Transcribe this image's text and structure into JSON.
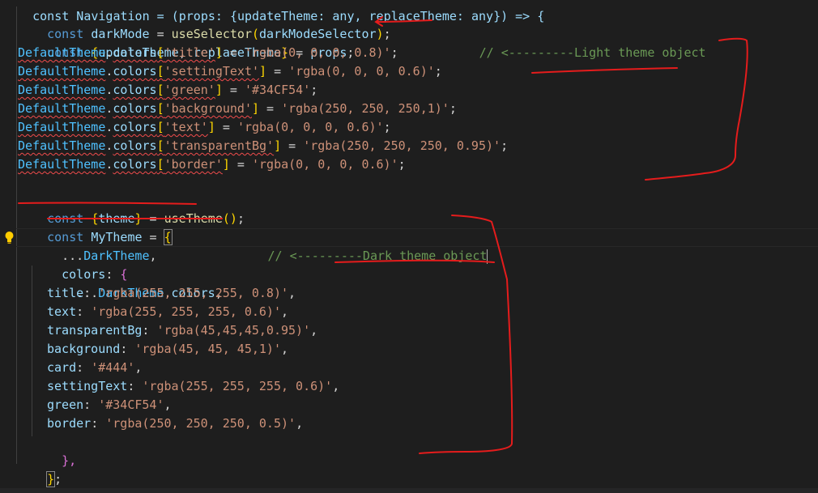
{
  "editor": {
    "top_line_partial": "const Navigation = (props: {updateTheme: any, replaceTheme: any}) => {",
    "line_dark_mode": {
      "kw": "const",
      "var": "darkMode",
      "eq": " = ",
      "fn": "useSelector",
      "open": "(",
      "arg": "darkModeSelector",
      "close": ")",
      "end": ";"
    },
    "line_props": {
      "kw": "const",
      "open": "{",
      "var1": "updateTheme",
      "sep": ", ",
      "var2": "replaceTheme",
      "close": "}",
      "eq": " = ",
      "var3": "props",
      "end": ";"
    },
    "default_theme_obj": "DefaultTheme",
    "colors_prop": "colors",
    "light_assignments": [
      {
        "key": "'title'",
        "value": "'rgba(0, 0, 0, 0.8)'",
        "comment": "// <---------Light theme object"
      },
      {
        "key": "'settingText'",
        "value": "'rgba(0, 0, 0, 0.6)'"
      },
      {
        "key": "'green'",
        "value": "'#34CF54'"
      },
      {
        "key": "'background'",
        "value": "'rgba(250, 250, 250,1)'"
      },
      {
        "key": "'text'",
        "value": "'rgba(0, 0, 0, 0.6)'"
      },
      {
        "key": "'transparentBg'",
        "value": "'rgba(250, 250, 250, 0.95)'"
      },
      {
        "key": "'border'",
        "value": "'rgba(0, 0, 0, 0.6)'"
      }
    ],
    "line_use_theme": {
      "kw": "const",
      "open": "{",
      "var": "theme",
      "close": "}",
      "eq": " = ",
      "fn": "useTheme",
      "call": "()",
      "end": ";"
    },
    "line_my_theme": {
      "kw": "const",
      "var": "MyTheme",
      "eq": " = ",
      "open": "{"
    },
    "spread_dark": {
      "spread": "...",
      "name": "DarkTheme",
      "comma": ",",
      "comment": "// <---------Dark theme object"
    },
    "colors_open": {
      "key": "colors",
      "colon": ": ",
      "open": "{"
    },
    "spread_colors": {
      "spread": "...",
      "obj": "DarkTheme",
      "dot": ".",
      "prop": "colors",
      "comma": ","
    },
    "dark_props": [
      {
        "key": "title",
        "value": "'rgba(255, 255, 255, 0.8)'"
      },
      {
        "key": "text",
        "value": "'rgba(255, 255, 255, 0.6)'"
      },
      {
        "key": "transparentBg",
        "value": "'rgba(45,45,45,0.95)'"
      },
      {
        "key": "background",
        "value": "'rgba(45, 45, 45,1)'"
      },
      {
        "key": "card",
        "value": "'#444'"
      },
      {
        "key": "settingText",
        "value": "'rgba(255, 255, 255, 0.6)'"
      },
      {
        "key": "green",
        "value": "'#34CF54'"
      },
      {
        "key": "border",
        "value": "'rgba(250, 250, 250, 0.5)'"
      }
    ],
    "close_colors": "},",
    "close_theme": "}",
    "close_theme_end": ";"
  },
  "icons": {
    "lightbulb": "lightbulb-icon"
  },
  "colors": {
    "background": "#1e1e1e",
    "keyword": "#569cd6",
    "variable": "#9cdcfe",
    "class": "#4fc1ff",
    "function": "#dcdcaa",
    "string": "#ce9178",
    "comment": "#6a9955",
    "annotation": "#e51c1c"
  }
}
